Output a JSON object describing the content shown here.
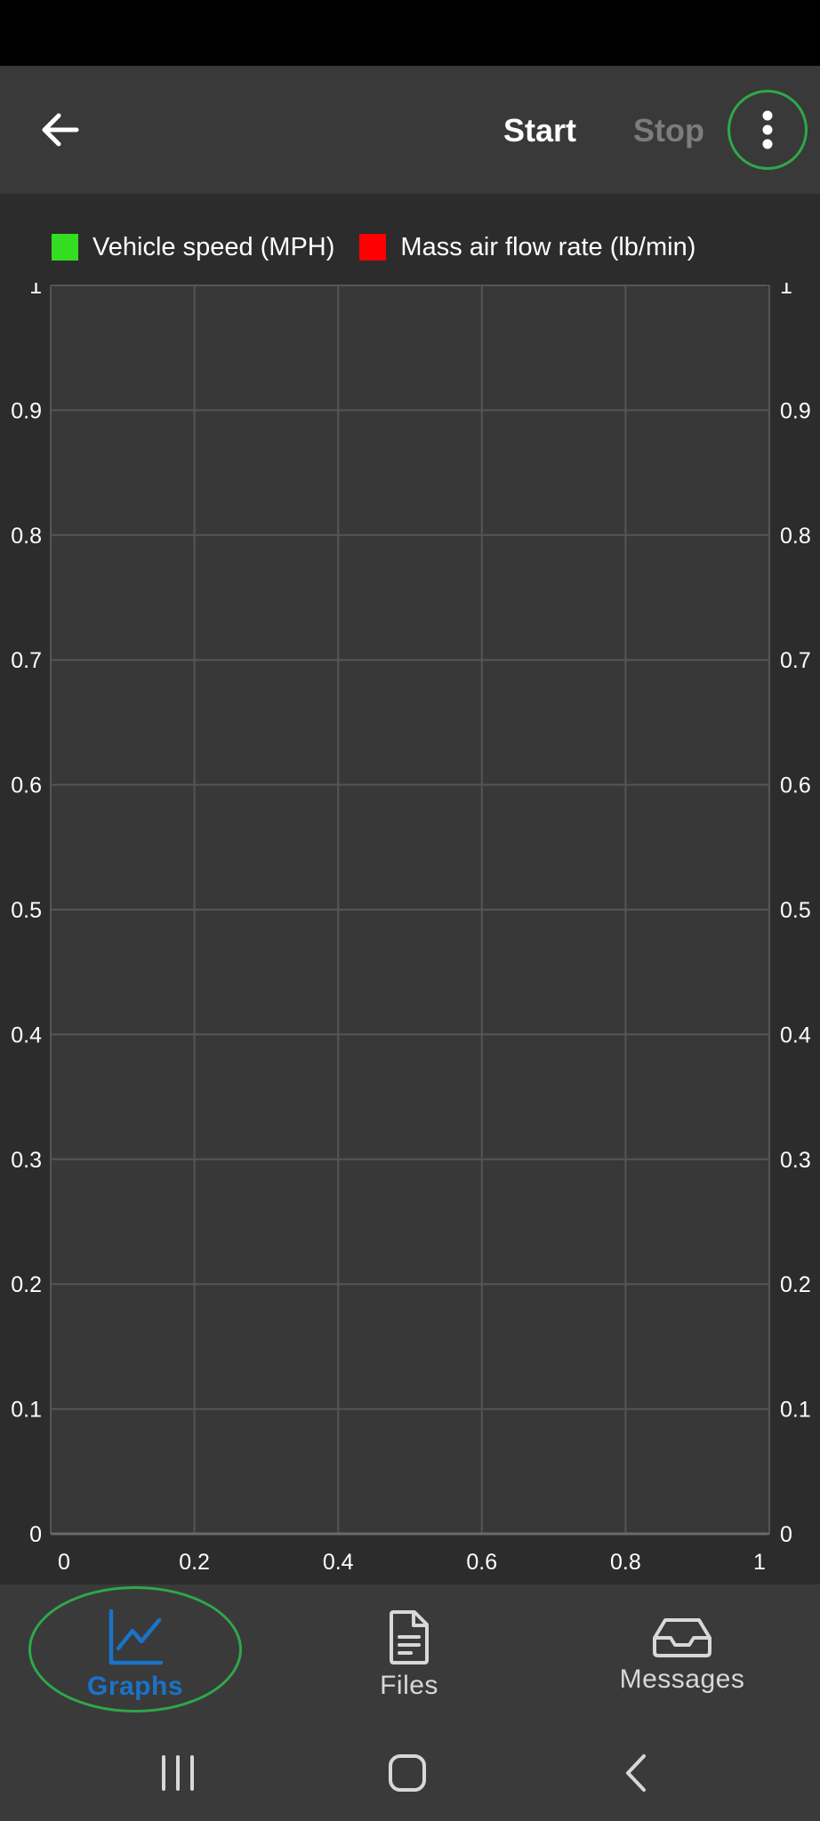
{
  "toolbar": {
    "start_label": "Start",
    "stop_label": "Stop",
    "back_icon": "arrow-left-icon",
    "menu_icon": "more-vert-icon"
  },
  "colors": {
    "accent_blue": "#1a73c8",
    "highlight_green": "#2ea84a",
    "series_speed": "#33dd22",
    "series_maf": "#ff0000"
  },
  "chart_data": {
    "type": "line",
    "series": [
      {
        "name": "Vehicle speed (MPH)",
        "color": "#33dd22",
        "values": []
      },
      {
        "name": "Mass air flow rate (lb/min)",
        "color": "#ff0000",
        "values": []
      }
    ],
    "x_ticks": [
      "0",
      "0.2",
      "0.4",
      "0.6",
      "0.8",
      "1"
    ],
    "y_ticks_left": [
      "0",
      "0.1",
      "0.2",
      "0.3",
      "0.4",
      "0.5",
      "0.6",
      "0.7",
      "0.8",
      "0.9",
      "1"
    ],
    "y_ticks_right": [
      "0",
      "0.1",
      "0.2",
      "0.3",
      "0.4",
      "0.5",
      "0.6",
      "0.7",
      "0.8",
      "0.9",
      "1"
    ],
    "xlim": [
      0,
      1
    ],
    "ylim": [
      0,
      1
    ],
    "grid": true,
    "legend_position": "top"
  },
  "bottom_nav": {
    "items": [
      {
        "label": "Graphs",
        "icon": "line-chart-icon",
        "active": true
      },
      {
        "label": "Files",
        "icon": "document-icon",
        "active": false
      },
      {
        "label": "Messages",
        "icon": "inbox-icon",
        "active": false
      }
    ]
  },
  "system_nav": {
    "recents_icon": "recents-icon",
    "home_icon": "home-icon",
    "back_icon": "back-chevron-icon"
  }
}
